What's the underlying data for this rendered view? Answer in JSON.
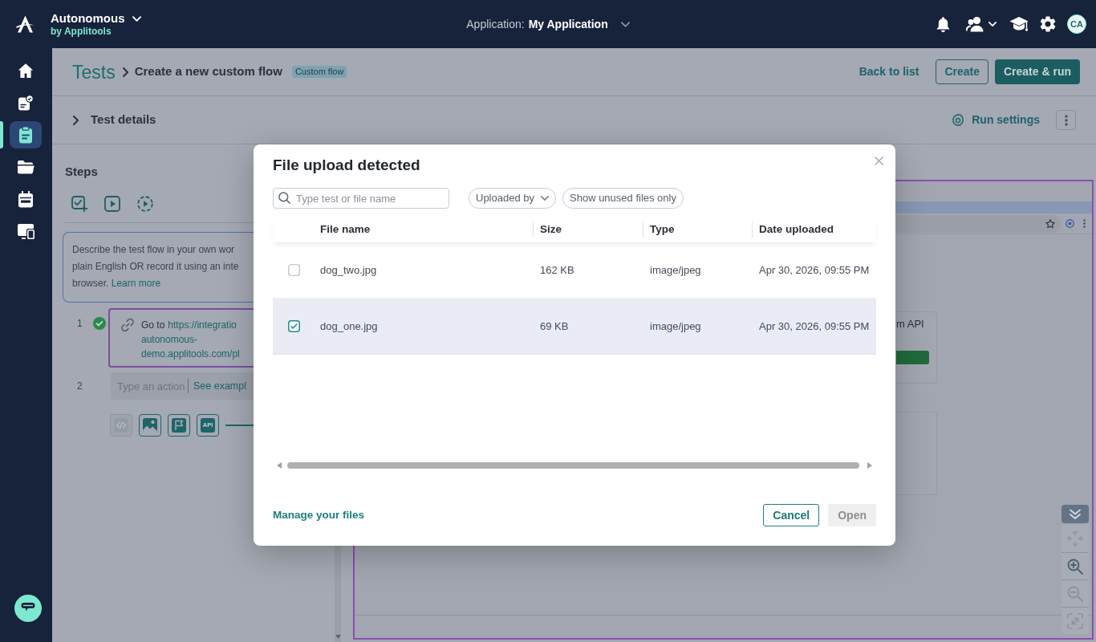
{
  "top_bar": {
    "product": "Autonomous",
    "vendor": "by Applitools",
    "application_label": "Application:",
    "application_name": "My Application",
    "avatar": "CA"
  },
  "nav": [
    {
      "kind": "home",
      "selected": false
    },
    {
      "kind": "reports",
      "selected": false
    },
    {
      "kind": "tests",
      "selected": true
    },
    {
      "kind": "files",
      "selected": false
    },
    {
      "kind": "schedule",
      "selected": false
    },
    {
      "kind": "devices",
      "selected": false
    }
  ],
  "header": {
    "breadcrumb": "Tests",
    "title": "Create a new custom flow",
    "tag": "Custom flow",
    "actions": [
      {
        "kind": "link",
        "label": "Back to list"
      },
      {
        "kind": "outline",
        "label": "Create"
      },
      {
        "kind": "primary",
        "label": "Create & run"
      }
    ]
  },
  "test_details": {
    "label": "Test details",
    "expanded": false,
    "run_settings": "Run settings"
  },
  "steps_panel": {
    "title": "Steps",
    "toolbar": [
      {
        "kind": "add_check"
      },
      {
        "kind": "play"
      },
      {
        "kind": "replay"
      }
    ],
    "info": {
      "lines": [
        "Describe the test flow in your own wor",
        "plain English OR record it using an inte",
        "browser."
      ],
      "link": "Learn more"
    },
    "steps": [
      {
        "kind": "action",
        "number": "1",
        "done": true,
        "lead": "Go to",
        "link_lines": [
          "https://integratio",
          "autonomous-",
          "demo.applitools.com/pl"
        ]
      },
      {
        "kind": "input",
        "number": "2",
        "placeholder": "Type an action",
        "link": "See exampl"
      }
    ],
    "tools": [
      {
        "kind": "code",
        "disabled": true
      },
      {
        "kind": "image",
        "disabled": false
      },
      {
        "kind": "flag",
        "disabled": false
      },
      {
        "kind": "api",
        "label": "API",
        "disabled": false
      }
    ]
  },
  "preview": {
    "card_text": "m API",
    "zoom_controls": [
      {
        "kind": "move",
        "disabled": true
      },
      {
        "kind": "zoom_in",
        "disabled": false
      },
      {
        "kind": "zoom_out",
        "disabled": true
      },
      {
        "kind": "fit",
        "disabled": true
      }
    ]
  },
  "dialog": {
    "title": "File upload detected",
    "search": {
      "placeholder": "Type test or file name"
    },
    "filters": [
      {
        "kind": "dropdown",
        "label": "Uploaded by"
      },
      {
        "kind": "chip",
        "label": "Show unused files only"
      }
    ],
    "columns": [
      "File name",
      "Size",
      "Type",
      "Date uploaded"
    ],
    "rows": [
      {
        "selected": false,
        "cells": [
          "dog_two.jpg",
          "162 KB",
          "image/jpeg",
          "Apr 30, 2026, 09:55 PM"
        ]
      },
      {
        "selected": true,
        "cells": [
          "dog_one.jpg",
          "69 KB",
          "image/jpeg",
          "Apr 30, 2026, 09:55 PM"
        ]
      }
    ],
    "link": "Manage your files",
    "buttons": [
      {
        "kind": "cancel",
        "label": "Cancel",
        "disabled": false
      },
      {
        "kind": "confirm",
        "label": "Open",
        "disabled": true
      }
    ]
  }
}
